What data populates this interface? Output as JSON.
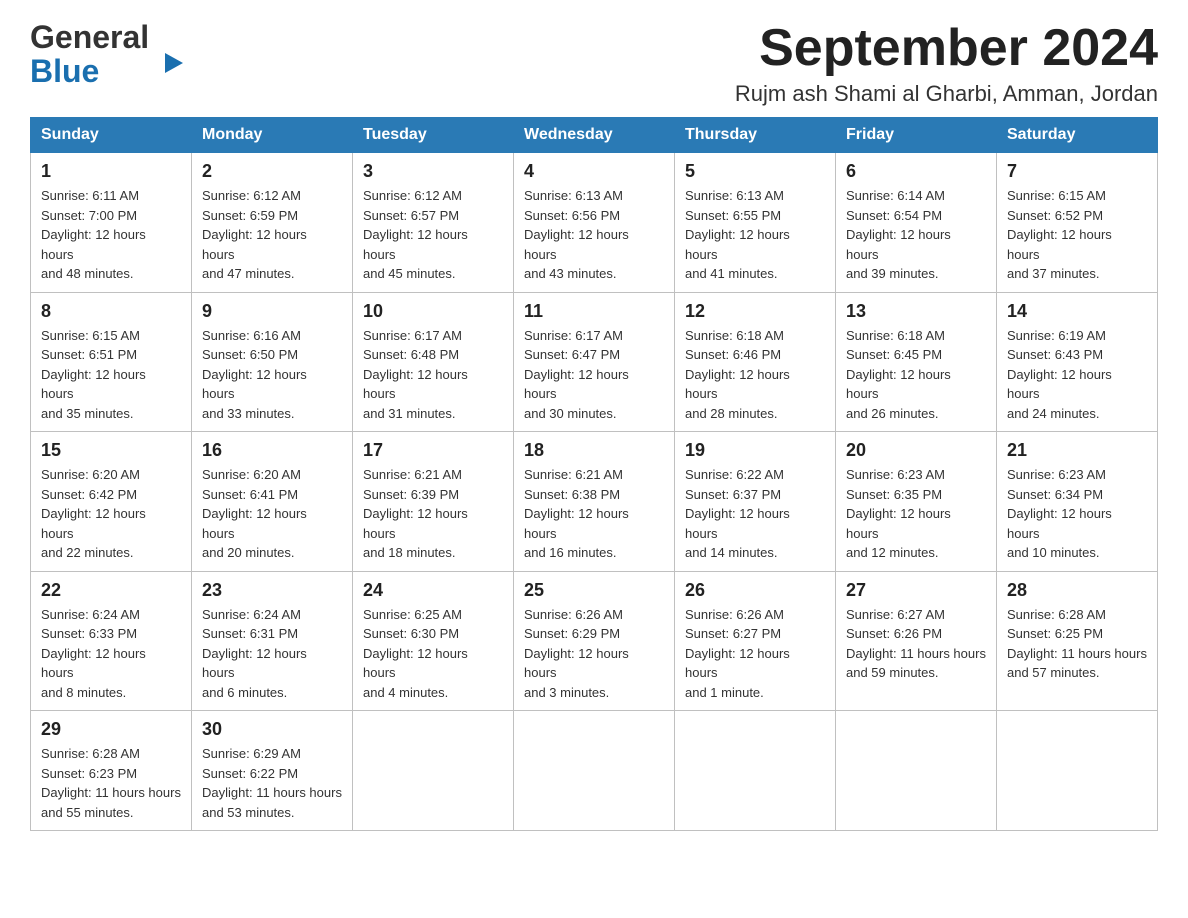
{
  "header": {
    "logo_general": "General",
    "logo_blue": "Blue",
    "month_year": "September 2024",
    "location": "Rujm ash Shami al Gharbi, Amman, Jordan"
  },
  "days_of_week": [
    "Sunday",
    "Monday",
    "Tuesday",
    "Wednesday",
    "Thursday",
    "Friday",
    "Saturday"
  ],
  "weeks": [
    [
      {
        "day": "1",
        "sunrise": "6:11 AM",
        "sunset": "7:00 PM",
        "daylight": "12 hours and 48 minutes."
      },
      {
        "day": "2",
        "sunrise": "6:12 AM",
        "sunset": "6:59 PM",
        "daylight": "12 hours and 47 minutes."
      },
      {
        "day": "3",
        "sunrise": "6:12 AM",
        "sunset": "6:57 PM",
        "daylight": "12 hours and 45 minutes."
      },
      {
        "day": "4",
        "sunrise": "6:13 AM",
        "sunset": "6:56 PM",
        "daylight": "12 hours and 43 minutes."
      },
      {
        "day": "5",
        "sunrise": "6:13 AM",
        "sunset": "6:55 PM",
        "daylight": "12 hours and 41 minutes."
      },
      {
        "day": "6",
        "sunrise": "6:14 AM",
        "sunset": "6:54 PM",
        "daylight": "12 hours and 39 minutes."
      },
      {
        "day": "7",
        "sunrise": "6:15 AM",
        "sunset": "6:52 PM",
        "daylight": "12 hours and 37 minutes."
      }
    ],
    [
      {
        "day": "8",
        "sunrise": "6:15 AM",
        "sunset": "6:51 PM",
        "daylight": "12 hours and 35 minutes."
      },
      {
        "day": "9",
        "sunrise": "6:16 AM",
        "sunset": "6:50 PM",
        "daylight": "12 hours and 33 minutes."
      },
      {
        "day": "10",
        "sunrise": "6:17 AM",
        "sunset": "6:48 PM",
        "daylight": "12 hours and 31 minutes."
      },
      {
        "day": "11",
        "sunrise": "6:17 AM",
        "sunset": "6:47 PM",
        "daylight": "12 hours and 30 minutes."
      },
      {
        "day": "12",
        "sunrise": "6:18 AM",
        "sunset": "6:46 PM",
        "daylight": "12 hours and 28 minutes."
      },
      {
        "day": "13",
        "sunrise": "6:18 AM",
        "sunset": "6:45 PM",
        "daylight": "12 hours and 26 minutes."
      },
      {
        "day": "14",
        "sunrise": "6:19 AM",
        "sunset": "6:43 PM",
        "daylight": "12 hours and 24 minutes."
      }
    ],
    [
      {
        "day": "15",
        "sunrise": "6:20 AM",
        "sunset": "6:42 PM",
        "daylight": "12 hours and 22 minutes."
      },
      {
        "day": "16",
        "sunrise": "6:20 AM",
        "sunset": "6:41 PM",
        "daylight": "12 hours and 20 minutes."
      },
      {
        "day": "17",
        "sunrise": "6:21 AM",
        "sunset": "6:39 PM",
        "daylight": "12 hours and 18 minutes."
      },
      {
        "day": "18",
        "sunrise": "6:21 AM",
        "sunset": "6:38 PM",
        "daylight": "12 hours and 16 minutes."
      },
      {
        "day": "19",
        "sunrise": "6:22 AM",
        "sunset": "6:37 PM",
        "daylight": "12 hours and 14 minutes."
      },
      {
        "day": "20",
        "sunrise": "6:23 AM",
        "sunset": "6:35 PM",
        "daylight": "12 hours and 12 minutes."
      },
      {
        "day": "21",
        "sunrise": "6:23 AM",
        "sunset": "6:34 PM",
        "daylight": "12 hours and 10 minutes."
      }
    ],
    [
      {
        "day": "22",
        "sunrise": "6:24 AM",
        "sunset": "6:33 PM",
        "daylight": "12 hours and 8 minutes."
      },
      {
        "day": "23",
        "sunrise": "6:24 AM",
        "sunset": "6:31 PM",
        "daylight": "12 hours and 6 minutes."
      },
      {
        "day": "24",
        "sunrise": "6:25 AM",
        "sunset": "6:30 PM",
        "daylight": "12 hours and 4 minutes."
      },
      {
        "day": "25",
        "sunrise": "6:26 AM",
        "sunset": "6:29 PM",
        "daylight": "12 hours and 3 minutes."
      },
      {
        "day": "26",
        "sunrise": "6:26 AM",
        "sunset": "6:27 PM",
        "daylight": "12 hours and 1 minute."
      },
      {
        "day": "27",
        "sunrise": "6:27 AM",
        "sunset": "6:26 PM",
        "daylight": "11 hours and 59 minutes."
      },
      {
        "day": "28",
        "sunrise": "6:28 AM",
        "sunset": "6:25 PM",
        "daylight": "11 hours and 57 minutes."
      }
    ],
    [
      {
        "day": "29",
        "sunrise": "6:28 AM",
        "sunset": "6:23 PM",
        "daylight": "11 hours and 55 minutes."
      },
      {
        "day": "30",
        "sunrise": "6:29 AM",
        "sunset": "6:22 PM",
        "daylight": "11 hours and 53 minutes."
      },
      {
        "day": "",
        "sunrise": "",
        "sunset": "",
        "daylight": ""
      },
      {
        "day": "",
        "sunrise": "",
        "sunset": "",
        "daylight": ""
      },
      {
        "day": "",
        "sunrise": "",
        "sunset": "",
        "daylight": ""
      },
      {
        "day": "",
        "sunrise": "",
        "sunset": "",
        "daylight": ""
      },
      {
        "day": "",
        "sunrise": "",
        "sunset": "",
        "daylight": ""
      }
    ]
  ],
  "labels": {
    "sunrise": "Sunrise:",
    "sunset": "Sunset:",
    "daylight": "Daylight:"
  }
}
